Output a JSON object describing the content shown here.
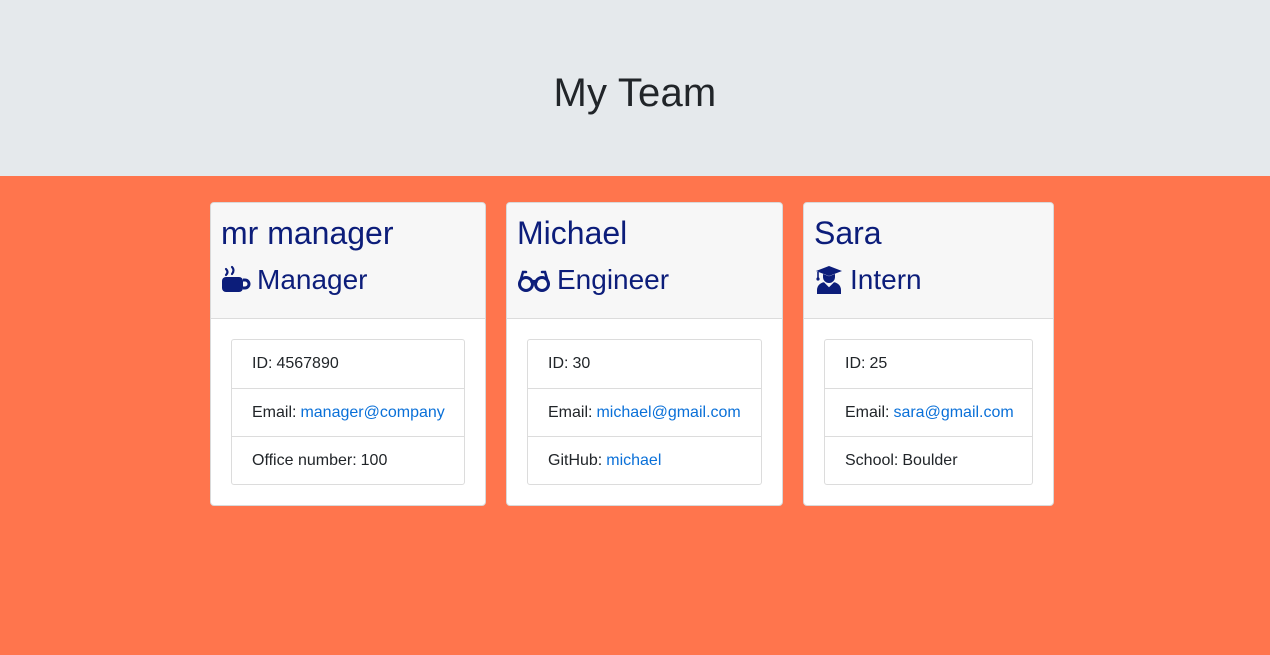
{
  "header": {
    "title": "My Team"
  },
  "colors": {
    "page_background": "#ff754d",
    "jumbotron_background": "#e5e9ec",
    "name_color": "#0c1d7a",
    "link_color": "#0a70d8"
  },
  "employees": [
    {
      "name": "mr manager",
      "role": "Manager",
      "role_icon": "mug-icon",
      "id_label": "ID:",
      "id": "4567890",
      "email_label": "Email:",
      "email": "manager@company",
      "extra_label": "Office number:",
      "extra_value": "100"
    },
    {
      "name": "Michael",
      "role": "Engineer",
      "role_icon": "glasses-icon",
      "id_label": "ID:",
      "id": "30",
      "email_label": "Email:",
      "email": "michael@gmail.com",
      "extra_label": "GitHub:",
      "extra_value": "michael"
    },
    {
      "name": "Sara",
      "role": "Intern",
      "role_icon": "graduate-icon",
      "id_label": "ID:",
      "id": "25",
      "email_label": "Email:",
      "email": "sara@gmail.com",
      "extra_label": "School:",
      "extra_value": "Boulder"
    }
  ]
}
